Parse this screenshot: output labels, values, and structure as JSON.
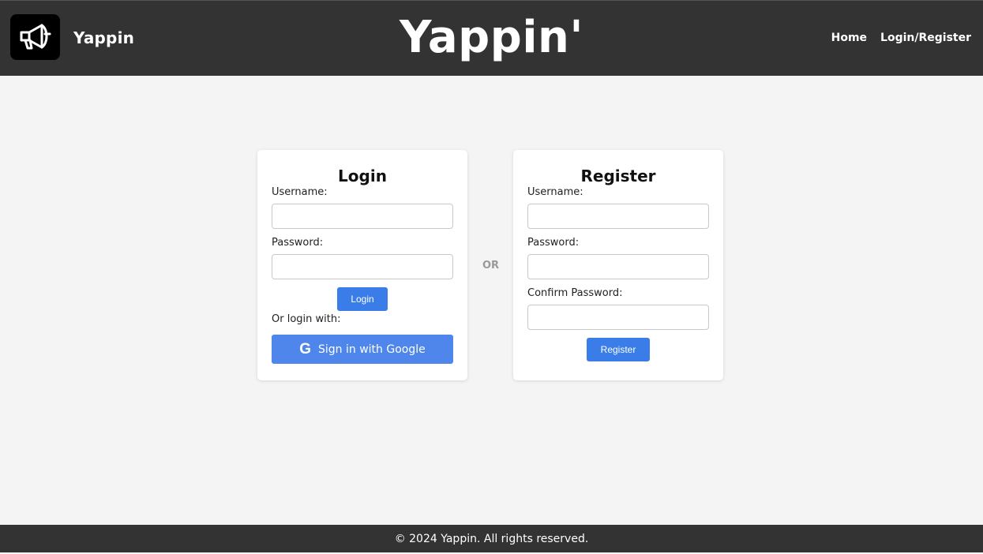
{
  "header": {
    "logo_icon": "megaphone-icon",
    "brand_name": "Yappin",
    "site_title": "Yappin'",
    "nav": [
      {
        "label": "Home"
      },
      {
        "label": "Login/Register"
      }
    ]
  },
  "login": {
    "title": "Login",
    "username_label": "Username:",
    "username_value": "",
    "password_label": "Password:",
    "password_value": "",
    "submit_label": "Login",
    "or_login_with": "Or login with:",
    "google_icon": "google-g-icon",
    "google_label": "Sign in with Google"
  },
  "divider_text": "OR",
  "register": {
    "title": "Register",
    "username_label": "Username:",
    "username_value": "",
    "password_label": "Password:",
    "password_value": "",
    "confirm_label": "Confirm Password:",
    "confirm_value": "",
    "submit_label": "Register"
  },
  "footer": {
    "text": "© 2024 Yappin. All rights reserved."
  },
  "colors": {
    "header_bg": "#333333",
    "page_bg": "#f4f4f4",
    "primary_button": "#3b7de8",
    "google_button": "#4f86ec"
  }
}
